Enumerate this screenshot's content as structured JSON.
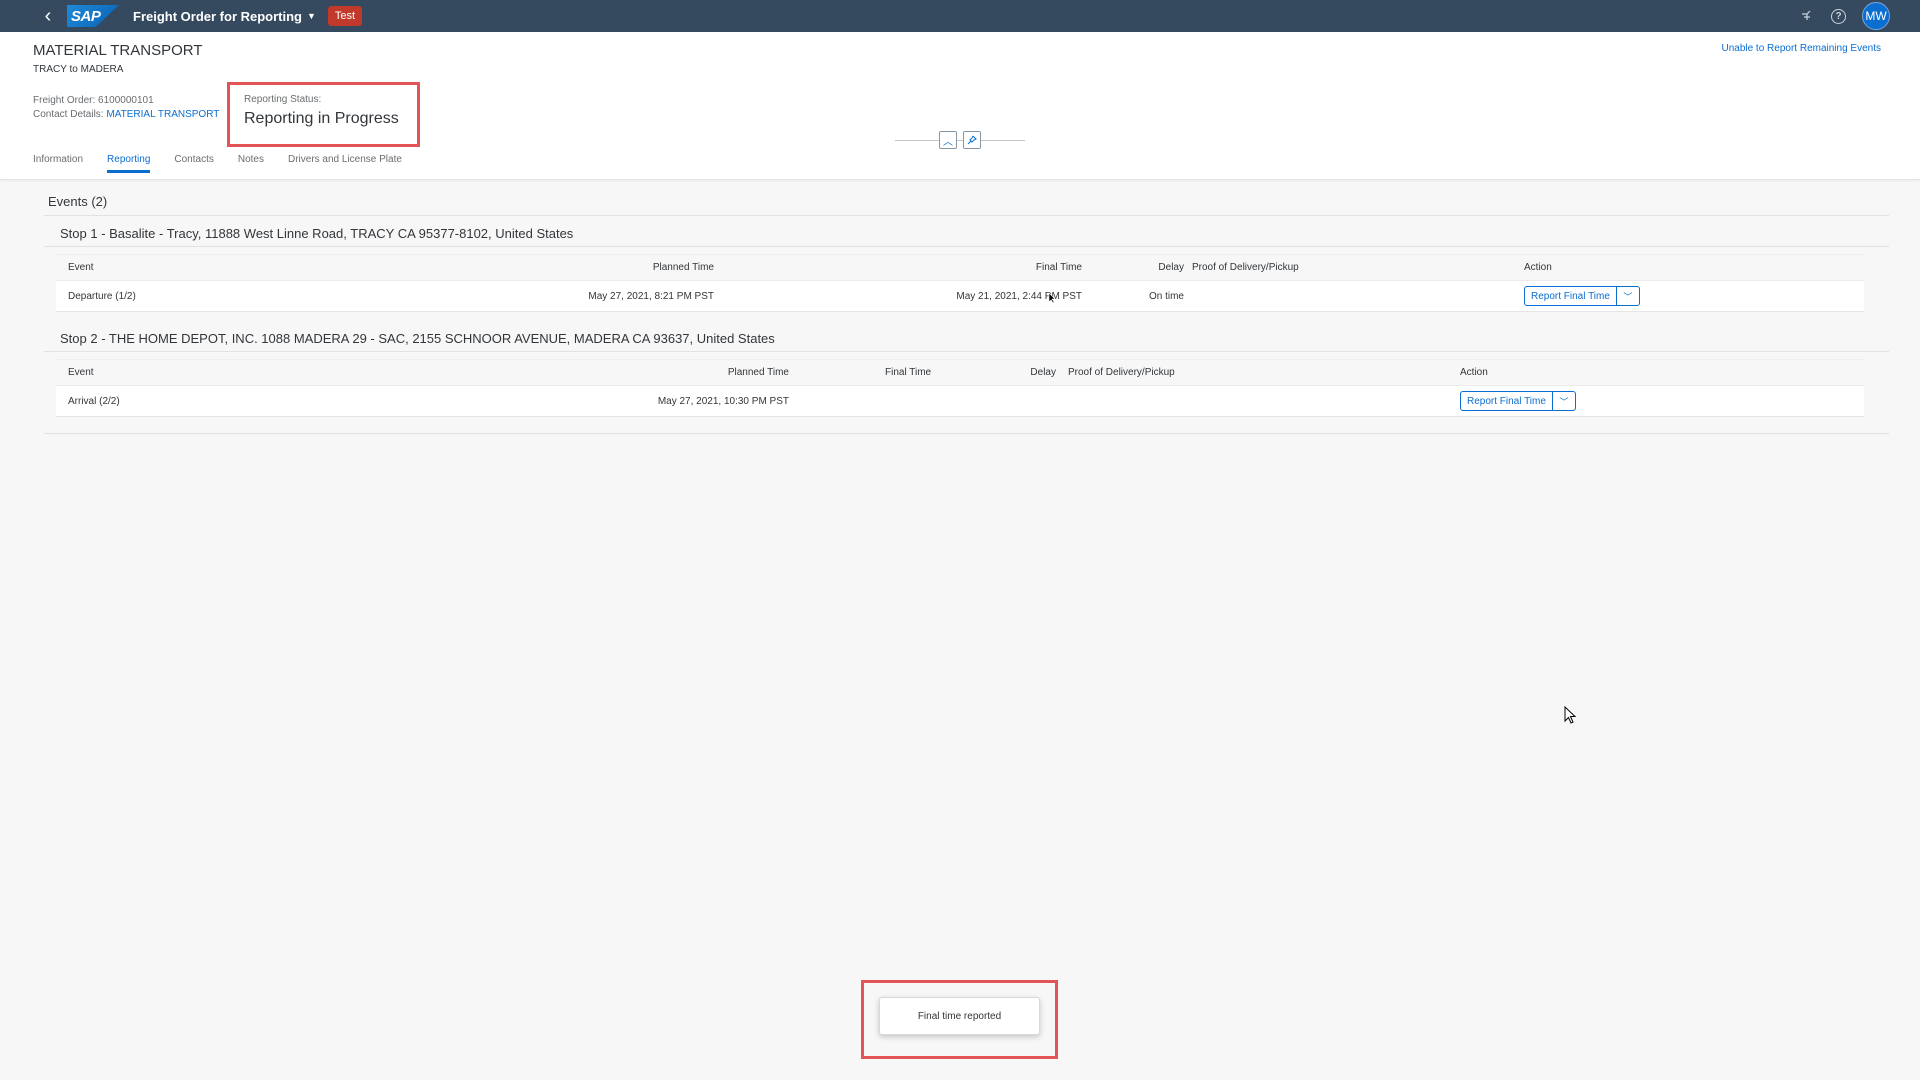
{
  "shell": {
    "back_icon": "chevron-left-icon",
    "logo_text": "SAP",
    "app_title": "Freight Order for Reporting",
    "env_badge": "Test",
    "avatar_initials": "MW",
    "env_badge_color": "#c0392b",
    "shell_color": "#354a5f"
  },
  "header": {
    "title": "MATERIAL TRANSPORT",
    "subtitle": "TRACY to MADERA",
    "freight_order_label": "Freight Order:",
    "freight_order_value": "6100000101",
    "contact_label": "Contact Details:",
    "contact_value": "MATERIAL TRANSPORT",
    "status_label": "Reporting Status:",
    "status_value": "Reporting in Progress",
    "top_action": "Unable to Report Remaining Events"
  },
  "tabs": [
    {
      "label": "Information"
    },
    {
      "label": "Reporting"
    },
    {
      "label": "Contacts"
    },
    {
      "label": "Notes"
    },
    {
      "label": "Drivers and License Plate"
    }
  ],
  "active_tab": "Reporting",
  "events": {
    "title": "Events (2)",
    "stops": [
      {
        "title": "Stop 1 - Basalite - Tracy, 11888 West Linne Road, TRACY CA 95377-8102, United States",
        "headers": {
          "event": "Event",
          "planned": "Planned Time",
          "final": "Final Time",
          "delay": "Delay",
          "proof": "Proof of Delivery/Pickup",
          "action": "Action"
        },
        "rows": [
          {
            "event": "Departure (1/2)",
            "planned": "May 27, 2021, 8:21 PM PST",
            "final": "May 21, 2021, 2:44 PM PST",
            "delay": "On time",
            "proof": "",
            "action": "Report Final Time"
          }
        ]
      },
      {
        "title": "Stop 2 - THE HOME DEPOT, INC. 1088 MADERA 29 - SAC, 2155 SCHNOOR AVENUE, MADERA CA 93637, United States",
        "headers": {
          "event": "Event",
          "planned": "Planned Time",
          "final": "Final Time",
          "delay": "Delay",
          "proof": "Proof of Delivery/Pickup",
          "action": "Action"
        },
        "rows": [
          {
            "event": "Arrival (2/2)",
            "planned": "May 27, 2021, 10:30 PM PST",
            "final": "",
            "delay": "",
            "proof": "",
            "action": "Report Final Time"
          }
        ]
      }
    ]
  },
  "toast": {
    "message": "Final time reported"
  },
  "colors": {
    "accent": "#0a6ed1",
    "highlight_border": "#e35456"
  }
}
